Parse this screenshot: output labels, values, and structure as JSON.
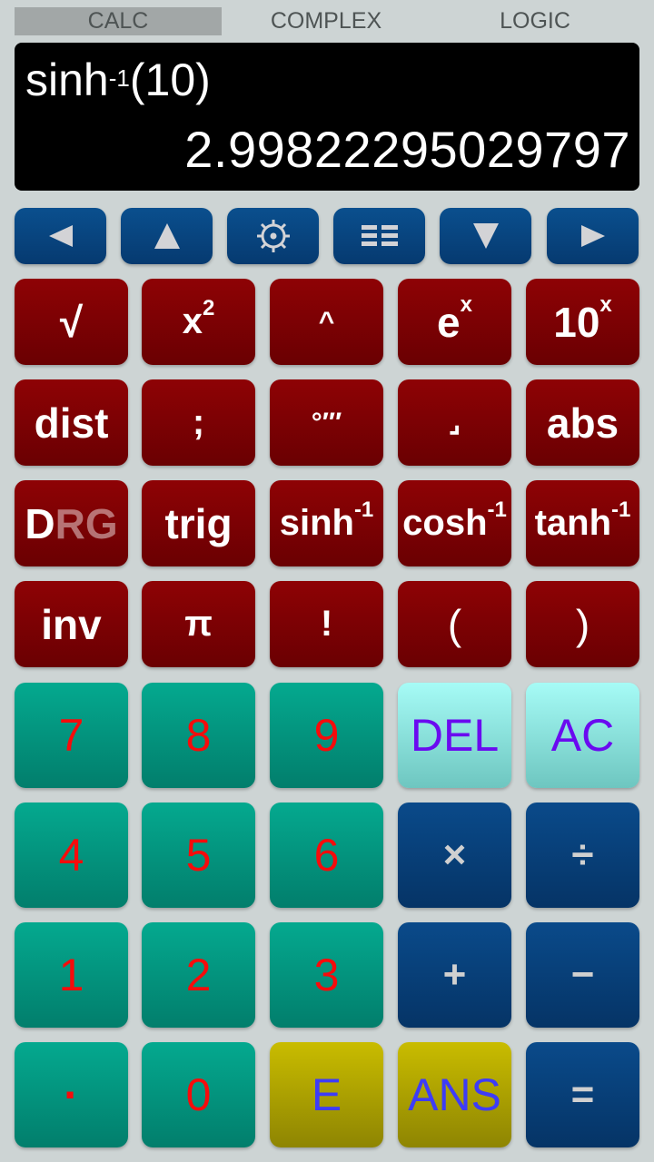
{
  "tabs": [
    {
      "label": "CALC",
      "selected": true
    },
    {
      "label": "COMPLEX",
      "selected": false
    },
    {
      "label": "LOGIC",
      "selected": false
    }
  ],
  "display": {
    "expression_func": "sinh",
    "expression_sup": "-1",
    "expression_arg": "(10)",
    "result": "2.99822295029797"
  },
  "nav_buttons": [
    {
      "icon": "arrow-left-icon"
    },
    {
      "icon": "arrow-up-icon"
    },
    {
      "icon": "settings-icon"
    },
    {
      "icon": "menu-list-icon"
    },
    {
      "icon": "arrow-down-icon"
    },
    {
      "icon": "arrow-right-icon"
    }
  ],
  "function_keys": {
    "row1": {
      "sqrt": "√",
      "square_base": "x",
      "square_sup": "2",
      "power": "^",
      "exp_base": "e",
      "exp_sup": "x",
      "tenpow_base": "10",
      "tenpow_sup": "x"
    },
    "row2": {
      "dist": "dist",
      "semicolon": ";",
      "dms": "°′″",
      "frac": "⌟",
      "abs": "abs"
    },
    "row3": {
      "drg_active": "D",
      "drg_inactive": "RG",
      "trig": "trig",
      "asinh_base": "sinh",
      "acosh_base": "cosh",
      "atanh_base": "tanh",
      "inverse_sup": "-1"
    },
    "row4": {
      "inv": "inv",
      "pi": "π",
      "factorial": "!",
      "lparen": "(",
      "rparen": ")"
    }
  },
  "keypad": {
    "seven": "7",
    "eight": "8",
    "nine": "9",
    "del": "DEL",
    "ac": "AC",
    "four": "4",
    "five": "5",
    "six": "6",
    "multiply": "×",
    "divide": "÷",
    "one": "1",
    "two": "2",
    "three": "3",
    "plus": "+",
    "minus": "−",
    "point": "·",
    "zero": "0",
    "exponent": "E",
    "ans": "ANS",
    "equals": "="
  },
  "colors": {
    "function_key": "#8e0205",
    "digit_key": "#04a98f",
    "digit_text": "#f70b0b",
    "nav_key": "#0a4f8e",
    "clear_key": "#a6fbf6",
    "clear_text": "#6a0af0",
    "entry_key": "#c9bc00",
    "entry_text": "#3d3cf7"
  }
}
